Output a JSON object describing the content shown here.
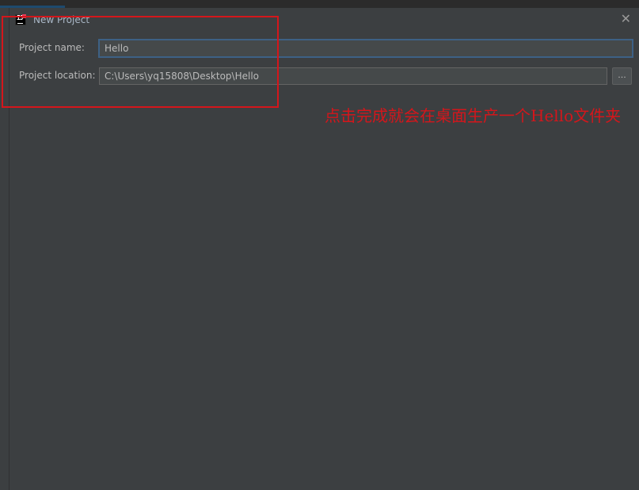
{
  "dialog": {
    "title": "New Project",
    "close_glyph": "✕",
    "project_name_label": "Project name:",
    "project_name_value": "Hello",
    "project_location_label": "Project location:",
    "project_location_value": "C:\\Users\\yq15808\\Desktop\\Hello",
    "browse_label": "..."
  },
  "annotation": {
    "text": "点击完成就会在桌面生产一个Hello文件夹",
    "color": "#d4161b"
  },
  "icons": {
    "app": "intellij-idea-icon",
    "close": "close-icon"
  }
}
